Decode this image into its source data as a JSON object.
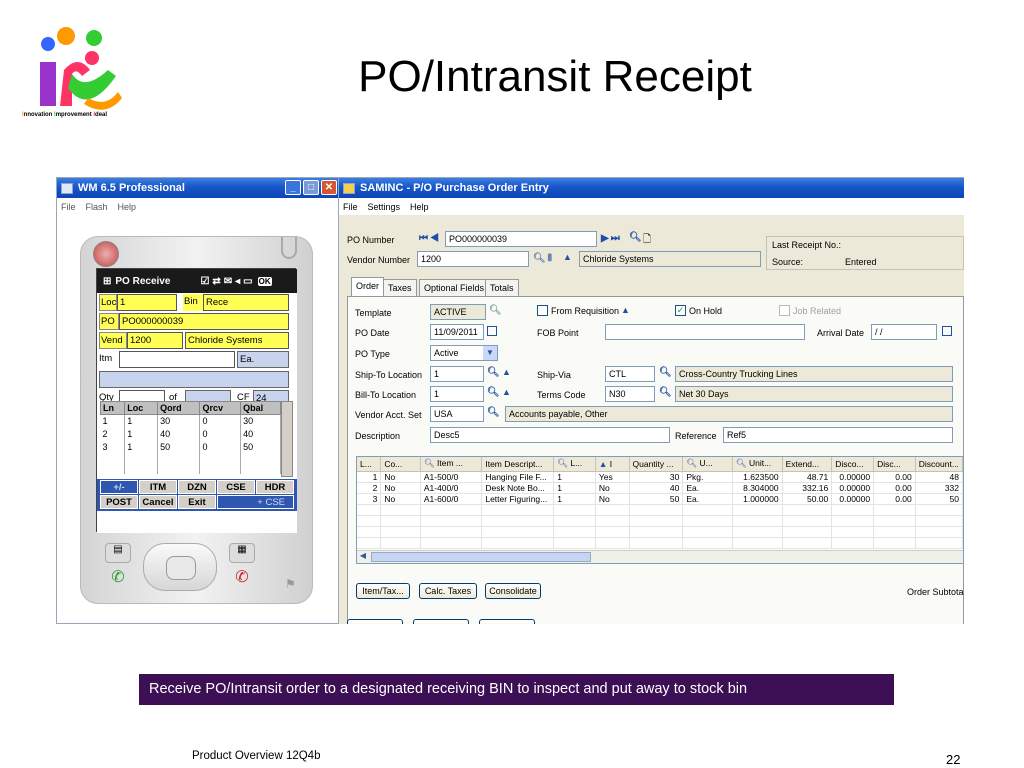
{
  "slide": {
    "title": "PO/Intransit Receipt",
    "caption": "Receive PO/Intransit order to a designated receiving BIN to inspect and put away to stock bin",
    "footer": "Product Overview 12Q4b",
    "page_number": "22"
  },
  "logo": {
    "tagline_i1": "I",
    "tagline_1": "nnovation ",
    "tagline_i2": "I",
    "tagline_2": "mprovement ",
    "tagline_i3": "I",
    "tagline_3": "deal",
    "colors": [
      "#ff9900",
      "#3366ff",
      "#33cc33",
      "#9933cc",
      "#ff3366"
    ]
  },
  "emulator": {
    "title": "WM 6.5 Professional",
    "menu": [
      "File",
      "Flash",
      "Help"
    ],
    "status_title": "PO Receive",
    "status_ok": "OK",
    "loc_label": "Loc",
    "loc_value": "1",
    "bin_label": "Bin",
    "bin_value": "Rece",
    "po_label": "PO",
    "po_value": "PO000000039",
    "vend_label": "Vend",
    "vend_code": "1200",
    "vend_name": "Chloride Systems",
    "itm_label": "Itm",
    "itm_value": "",
    "uom_value": "Ea.",
    "qty_label": "Qty",
    "qty_value": "",
    "of_label": "of",
    "of_value": "",
    "cf_label": "CF",
    "cf_value": "24",
    "table_headers": [
      "Ln",
      "Loc",
      "Qord",
      "Qrcv",
      "Qbal"
    ],
    "table_rows": [
      [
        "1",
        "1",
        "30",
        "0",
        "30"
      ],
      [
        "2",
        "1",
        "40",
        "0",
        "40"
      ],
      [
        "3",
        "1",
        "50",
        "0",
        "50"
      ]
    ],
    "btn_row1": [
      "+/-",
      "ITM",
      "DZN",
      "CSE",
      "HDR"
    ],
    "btn_row2": [
      "POST",
      "Cancel",
      "Exit",
      "+ CSE"
    ]
  },
  "erp": {
    "title": "SAMINC - P/O Purchase Order Entry",
    "menu": [
      "File",
      "Settings",
      "Help"
    ],
    "po_number_label": "PO Number",
    "po_number": "PO000000039",
    "vendor_label": "Vendor Number",
    "vendor_number": "1200",
    "vendor_name": "Chloride Systems",
    "last_receipt_label": "Last Receipt No.:",
    "source_label": "Source:",
    "source_value": "Entered",
    "tabs": [
      "Order",
      "Taxes",
      "Optional Fields",
      "Totals"
    ],
    "template_label": "Template",
    "template_value": "ACTIVE",
    "from_req_label": "From Requisition",
    "on_hold_label": "On Hold",
    "job_related_label": "Job Related",
    "po_date_label": "PO Date",
    "po_date": "11/09/2011",
    "fob_label": "FOB Point",
    "fob_value": "",
    "arrival_label": "Arrival Date",
    "arrival_value": "/ /",
    "po_type_label": "PO Type",
    "po_type": "Active",
    "shipto_label": "Ship-To Location",
    "shipto_value": "1",
    "shipvia_label": "Ship-Via",
    "shipvia_code": "CTL",
    "shipvia_name": "Cross-Country Trucking Lines",
    "billto_label": "Bill-To Location",
    "billto_value": "1",
    "terms_label": "Terms Code",
    "terms_code": "N30",
    "terms_name": "Net 30 Days",
    "acctset_label": "Vendor Acct. Set",
    "acctset_code": "USA",
    "acctset_name": "Accounts payable, Other",
    "desc_label": "Description",
    "desc_value": "Desc5",
    "ref_label": "Reference",
    "ref_value": "Ref5",
    "grid_headers": [
      "L...",
      "Co...",
      "Item ...",
      "Item Descript...",
      "L...",
      "I",
      "Quantity ...",
      "U...",
      "Unit...",
      "Extend...",
      "Disco...",
      "Disc...",
      "Discount..."
    ],
    "grid_rows": [
      [
        "1",
        "No",
        "A1-500/0",
        "Hanging File F...",
        "1",
        "Yes",
        "30",
        "Pkg.",
        "1.623500",
        "48.71",
        "0.00000",
        "0.00",
        "48"
      ],
      [
        "2",
        "No",
        "A1-400/0",
        "Desk Note Bo...",
        "1",
        "No",
        "40",
        "Ea.",
        "8.304000",
        "332.16",
        "0.00000",
        "0.00",
        "332"
      ],
      [
        "3",
        "No",
        "A1-600/0",
        "Letter Figuring...",
        "1",
        "No",
        "50",
        "Ea.",
        "1.000000",
        "50.00",
        "0.00000",
        "0.00",
        "50"
      ]
    ],
    "btn_item_tax": "Item/Tax...",
    "btn_calc_taxes": "Calc. Taxes",
    "btn_consolidate": "Consolidate",
    "order_subtotal_label": "Order Subtotal"
  }
}
